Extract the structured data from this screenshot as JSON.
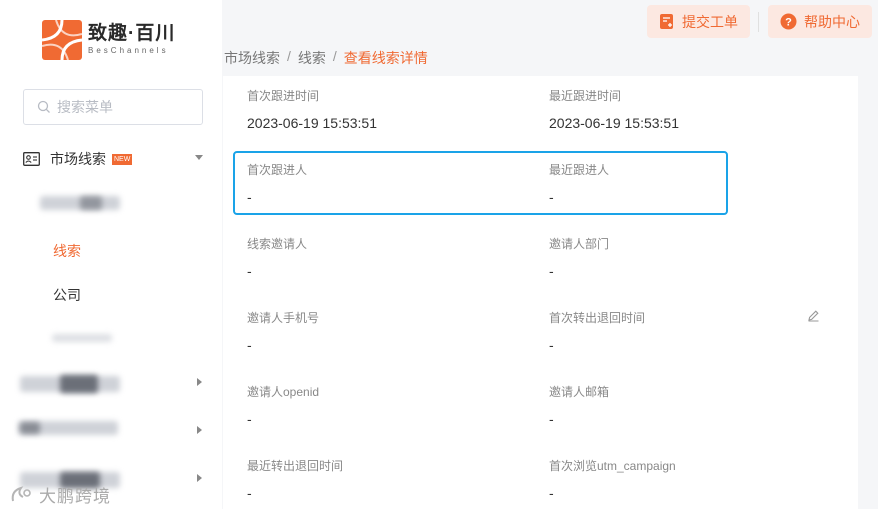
{
  "brand": {
    "name_cn": "致趣·百川",
    "name_en": "BesChannels",
    "color": "#f06a33"
  },
  "sidebar": {
    "search_placeholder": "搜索菜单",
    "group": {
      "label": "市场线索",
      "badge": "NEW"
    },
    "items": [
      {
        "label": "线索",
        "active": true
      },
      {
        "label": "公司",
        "active": false
      }
    ]
  },
  "header": {
    "submit_ticket": "提交工单",
    "help_center": "帮助中心"
  },
  "breadcrumb": [
    "市场线索",
    "线索",
    "查看线索详情"
  ],
  "fields": [
    {
      "label": "首次跟进时间",
      "value": "2023-06-19 15:53:51"
    },
    {
      "label": "最近跟进时间",
      "value": "2023-06-19 15:53:51"
    },
    {
      "label": "首次跟进人",
      "value": "-"
    },
    {
      "label": "最近跟进人",
      "value": "-"
    },
    {
      "label": "线索邀请人",
      "value": "-"
    },
    {
      "label": "邀请人部门",
      "value": "-"
    },
    {
      "label": "邀请人手机号",
      "value": "-"
    },
    {
      "label": "首次转出退回时间",
      "value": "-"
    },
    {
      "label": "邀请人openid",
      "value": "-"
    },
    {
      "label": "邀请人邮箱",
      "value": "-"
    },
    {
      "label": "最近转出退回时间",
      "value": "-"
    },
    {
      "label": "首次浏览utm_campaign",
      "value": "-"
    }
  ],
  "watermark": "大鹏跨境",
  "colors": {
    "accent": "#f06a33",
    "highlight_border": "#1aa3e8"
  }
}
